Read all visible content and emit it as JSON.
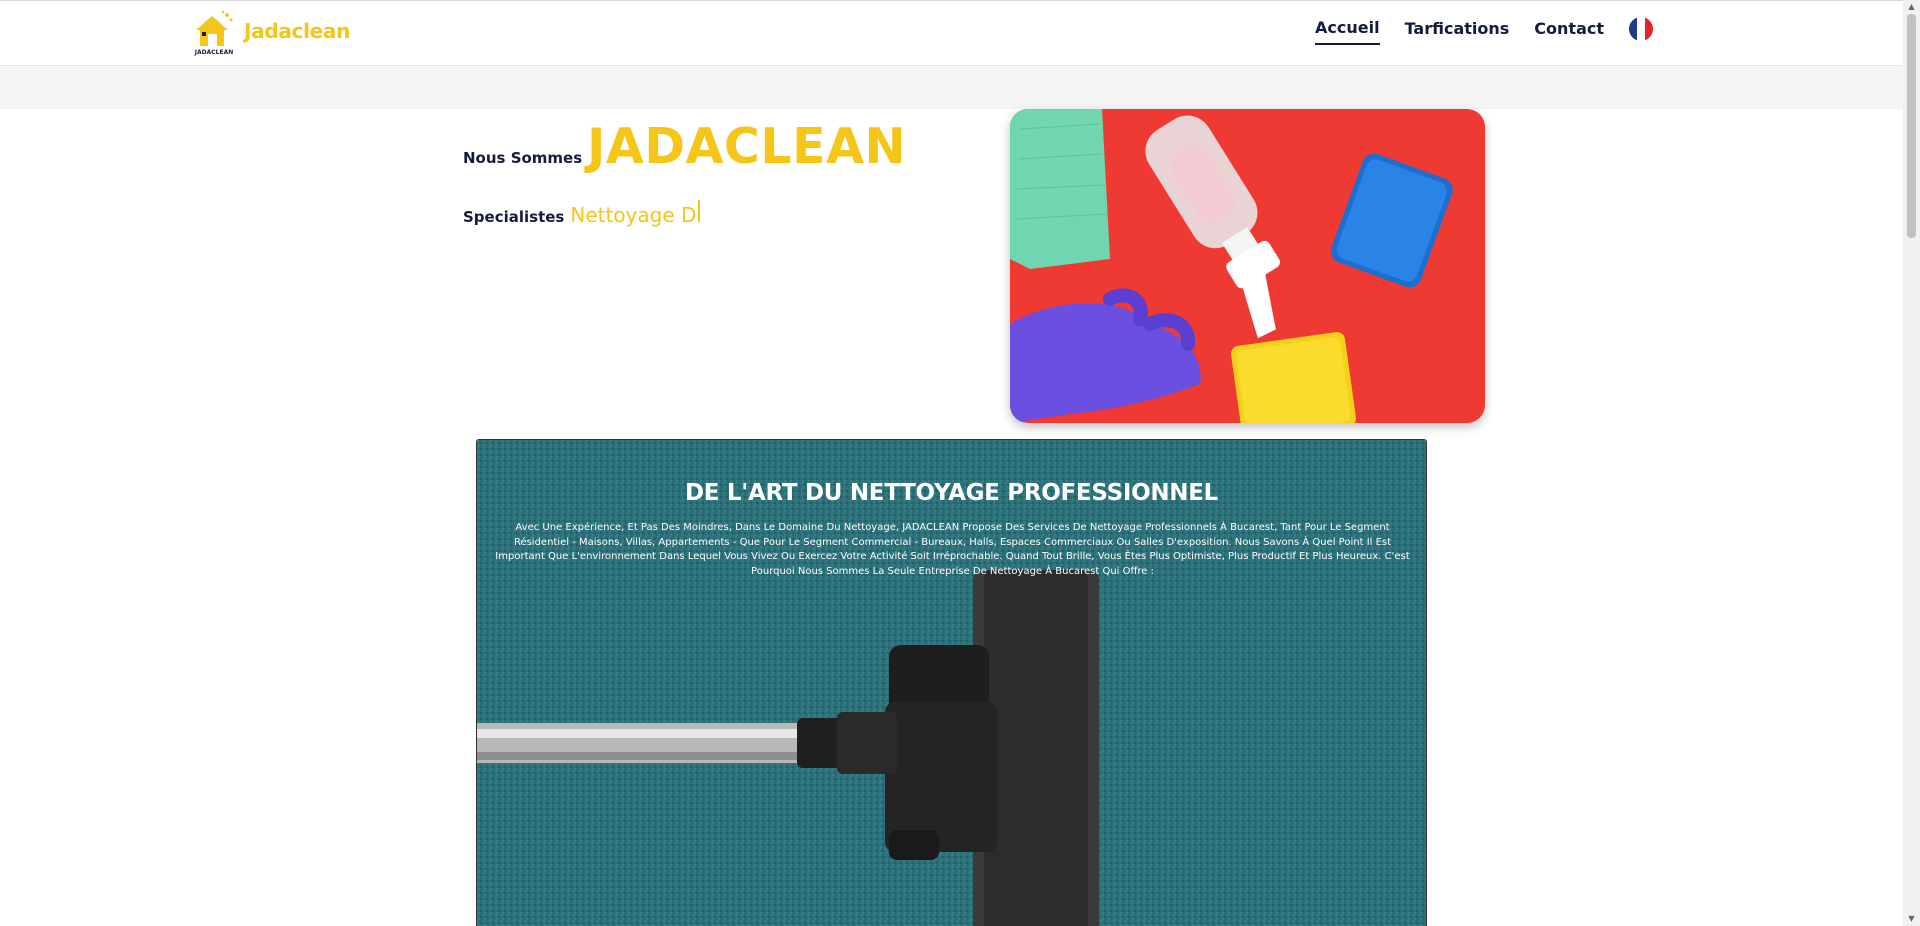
{
  "header": {
    "brand": "Jadaclean",
    "logo_text": "JADACLEAN",
    "nav": [
      {
        "label": "Accueil",
        "active": true
      },
      {
        "label": "Tarfications",
        "active": false
      },
      {
        "label": "Contact",
        "active": false
      }
    ],
    "language_flag": "fr-flag-icon"
  },
  "hero": {
    "line1_prefix": "Nous Sommes",
    "line1_highlight": "JADACLEAN",
    "line2_prefix": "Specialistes",
    "line2_typed": "Nettoyage D",
    "image": "cleaning-supplies-image"
  },
  "section": {
    "title": "DE L'ART DU NETTOYAGE PROFESSIONNEL",
    "text": "Avec Une Expérience, Et Pas Des Moindres, Dans Le Domaine Du Nettoyage, JADACLEAN Propose Des Services De Nettoyage Professionnels À Bucarest, Tant Pour Le Segment Résidentiel - Maisons, Villas, Appartements - Que Pour Le Segment Commercial - Bureaux, Halls, Espaces Commerciaux Ou Salles D'exposition. Nous Savons À Quel Point Il Est Important Que L'environnement Dans Lequel Vous Vivez Ou Exercez Votre Activité Soit Irréprochable. Quand Tout Brille, Vous Êtes Plus Optimiste, Plus Productif Et Plus Heureux. C'est Pourquoi Nous Sommes La Seule Entreprise De Nettoyage À Bucarest Qui Offre :",
    "image": "vacuum-cleaner-carpet-image"
  },
  "colors": {
    "brand_yellow": "#f5c518",
    "navy": "#151b3d",
    "carpet_teal": "#2b6f78"
  }
}
